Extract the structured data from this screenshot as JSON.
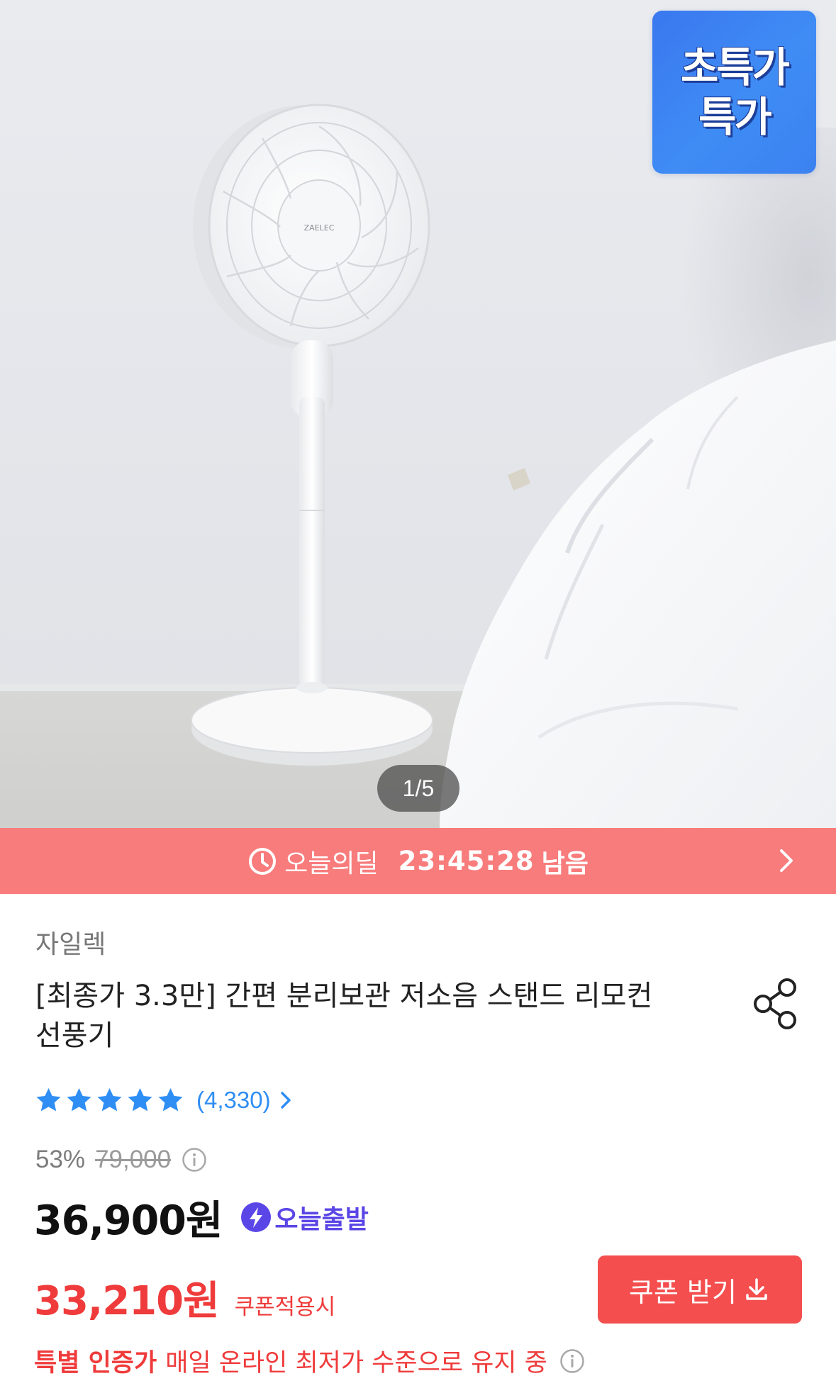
{
  "product_image": {
    "fan_logo_text": "ZAELEC",
    "badge_lines": [
      "초특가",
      "특가"
    ],
    "pager": "1/5"
  },
  "deal_bar": {
    "label": "오늘의딜",
    "timer": "23:45:28",
    "remaining": "남음"
  },
  "product": {
    "brand": "자일렉",
    "title": "[최종가 3.3만] 간편 분리보관 저소음 스탠드 리모컨 선풍기",
    "rating": 5,
    "review_count": "(4,330)",
    "discount_rate": "53%",
    "original_price": "79,000",
    "price": "36,900원",
    "shipping_badge": "오늘출발",
    "coupon_price": "33,210원",
    "coupon_note": "쿠폰적용시",
    "coupon_button": "쿠폰 받기",
    "certified_label": "특별 인증가",
    "certified_text": "매일 온라인 최저가 수준으로 유지 중"
  },
  "colors": {
    "deal_bar": "#f87c7c",
    "review_link": "#2f8ef4",
    "coupon_red": "#ef3b3b",
    "shipping_purple": "#5a46e6",
    "badge_blue": "#3a78ef"
  }
}
